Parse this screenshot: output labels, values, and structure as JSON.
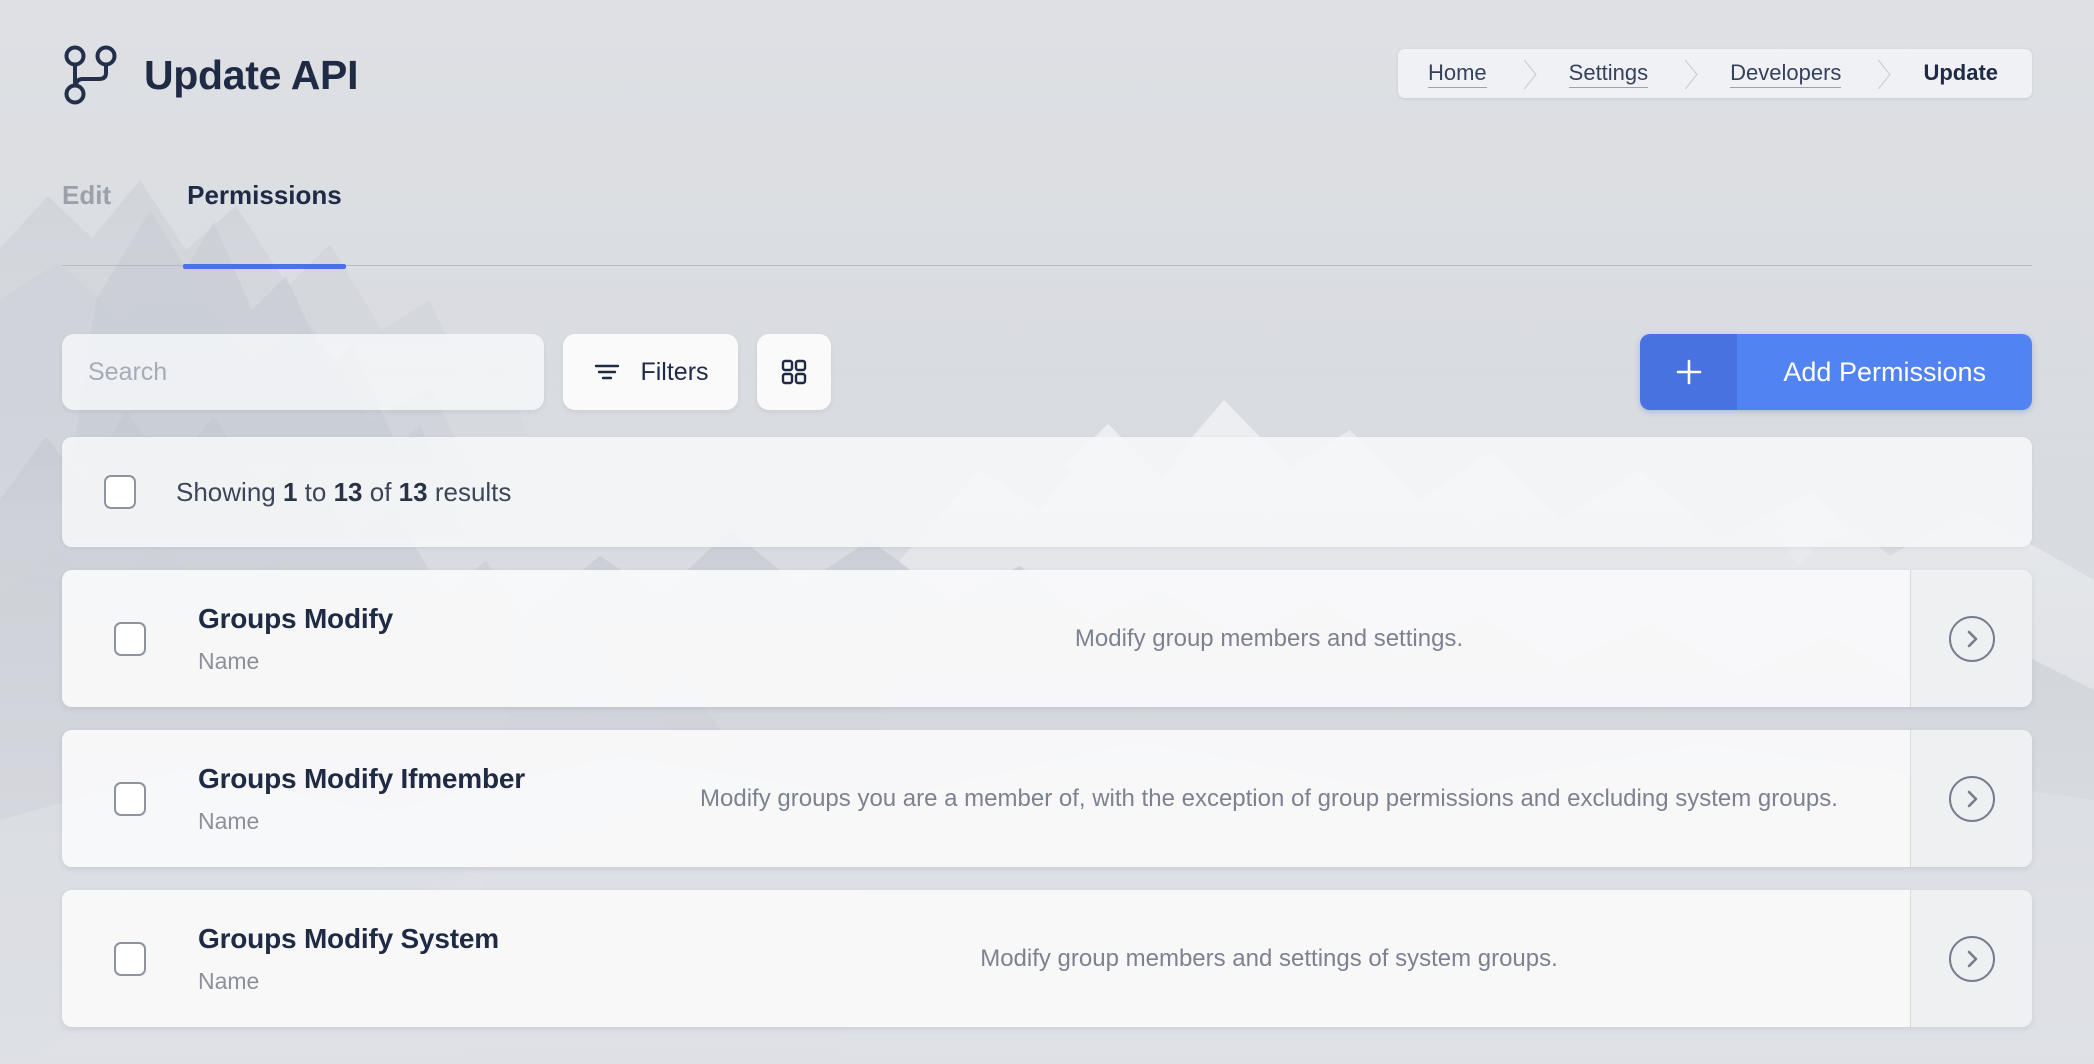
{
  "header": {
    "title": "Update API",
    "logo_icon": "git-branch-icon"
  },
  "breadcrumb": {
    "items": [
      {
        "label": "Home",
        "current": false
      },
      {
        "label": "Settings",
        "current": false
      },
      {
        "label": "Developers",
        "current": false
      },
      {
        "label": "Update",
        "current": true
      }
    ]
  },
  "tabs": [
    {
      "label": "Edit",
      "active": false
    },
    {
      "label": "Permissions",
      "active": true
    }
  ],
  "toolbar": {
    "search_placeholder": "Search",
    "search_value": "",
    "search_icon": "search-input",
    "filters_label": "Filters",
    "filters_icon": "filter-lines-icon",
    "grid_view_icon": "grid-squares-icon",
    "add_label": "Add Permissions",
    "add_icon": "plus-icon"
  },
  "results": {
    "prefix": "Showing",
    "from": "1",
    "mid": "to",
    "to": "13",
    "of": "of",
    "total": "13",
    "suffix": "results"
  },
  "colors": {
    "accent_blue": "#5183f2",
    "accent_blue_dark": "#4772e0",
    "tab_underline": "#4a72e8",
    "title_navy": "#1f2a44",
    "muted_gray": "#8b909b"
  },
  "rows": [
    {
      "title": "Groups Modify",
      "field_label": "Name",
      "description": "Modify group members and settings.",
      "action_icon": "chevron-right-circle-icon"
    },
    {
      "title": "Groups Modify Ifmember",
      "field_label": "Name",
      "description": "Modify groups you are a member of, with the exception of group permissions and excluding system groups.",
      "action_icon": "chevron-right-circle-icon"
    },
    {
      "title": "Groups Modify System",
      "field_label": "Name",
      "description": "Modify group members and settings of system groups.",
      "action_icon": "chevron-right-circle-icon"
    }
  ]
}
